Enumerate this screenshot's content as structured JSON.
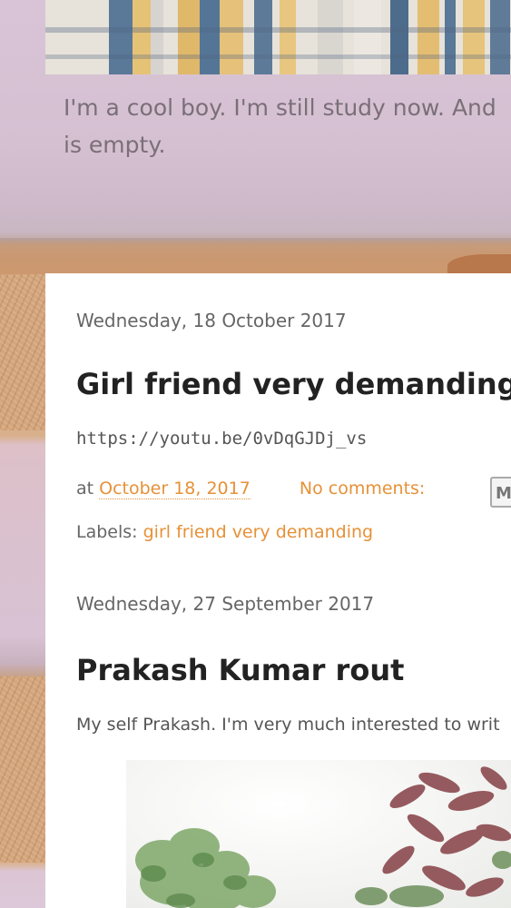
{
  "blog": {
    "description_line1": "I'm a cool boy. I'm still study now. And",
    "description_line2": "is empty."
  },
  "posts": [
    {
      "date": "Wednesday, 18 October 2017",
      "title": "Girl friend very demanding",
      "body": "https://youtu.be/0vDqGJDj_vs",
      "at_label": "at",
      "timestamp": "October 18, 2017",
      "comments": "No comments:",
      "labels_label": "Labels:",
      "label": "girl friend very demanding"
    },
    {
      "date": "Wednesday, 27 September 2017",
      "title": "Prakash Kumar rout",
      "body": "My self Prakash. I'm very much interested to writ"
    }
  ],
  "colors": {
    "link": "#e69138",
    "title": "#222222",
    "date": "#666666"
  },
  "icons": {
    "share": "email-share-icon"
  }
}
